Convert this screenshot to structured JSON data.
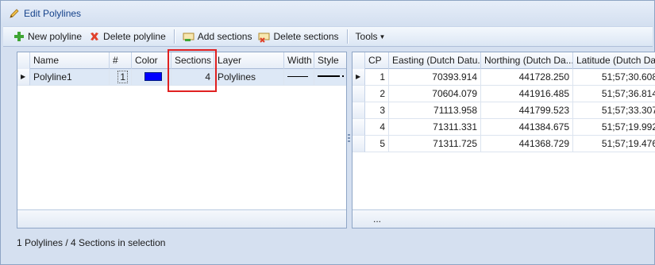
{
  "window": {
    "title": "Edit Polylines"
  },
  "toolbar": {
    "new_polyline": "New polyline",
    "delete_polyline": "Delete polyline",
    "add_sections": "Add sections",
    "delete_sections": "Delete sections",
    "tools": "Tools"
  },
  "polylines": {
    "headers": [
      "Name",
      "#",
      "Color",
      "Sections",
      "Layer",
      "Width",
      "Style"
    ],
    "rows": [
      {
        "name": "Polyline1",
        "num": "1",
        "color": "#0000ff",
        "sections": "4",
        "layer": "Polylines"
      }
    ]
  },
  "points": {
    "headers": [
      "CP",
      "Easting (Dutch Datu...",
      "Northing (Dutch Da...",
      "Latitude (Dutch Dat..."
    ],
    "rows": [
      {
        "cp": "1",
        "easting": "70393.914",
        "northing": "441728.250",
        "latitude": "51;57;30.608"
      },
      {
        "cp": "2",
        "easting": "70604.079",
        "northing": "441916.485",
        "latitude": "51;57;36.814"
      },
      {
        "cp": "3",
        "easting": "71113.958",
        "northing": "441799.523",
        "latitude": "51;57;33.307"
      },
      {
        "cp": "4",
        "easting": "71311.331",
        "northing": "441384.675",
        "latitude": "51;57;19.992"
      },
      {
        "cp": "5",
        "easting": "71311.725",
        "northing": "441368.729",
        "latitude": "51;57;19.476"
      }
    ],
    "footer": "..."
  },
  "status": {
    "text": "1 Polylines / 4 Sections in selection"
  },
  "colors": {
    "highlight": "#e02020",
    "selection": "#dde8f6"
  }
}
